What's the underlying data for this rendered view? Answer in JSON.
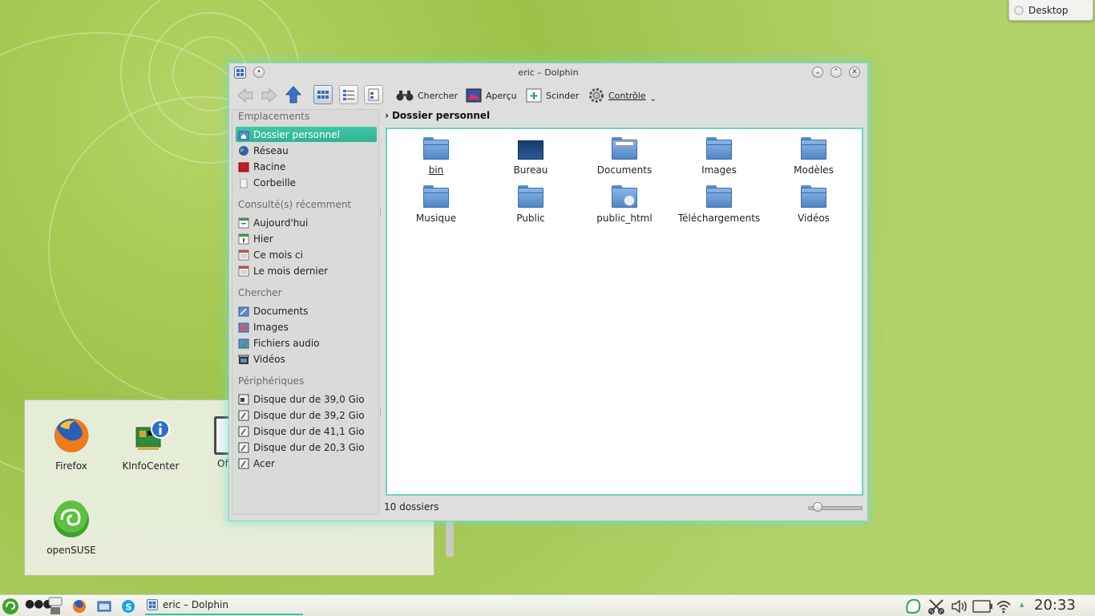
{
  "desktop_widget": {
    "label": "Desktop"
  },
  "folder_view": {
    "items": [
      {
        "label": "Firefox"
      },
      {
        "label": "KInfoCenter"
      },
      {
        "label": "Off"
      },
      {
        "label": "openSUSE"
      }
    ]
  },
  "window": {
    "title": "eric – Dolphin",
    "toolbar": {
      "search": "Chercher",
      "preview": "Aperçu",
      "split": "Scinder",
      "control": "Contrôle"
    },
    "places": {
      "groups": [
        {
          "label": "Emplacements",
          "items": [
            "Dossier personnel",
            "Réseau",
            "Racine",
            "Corbeille"
          ]
        },
        {
          "label": "Consulté(s) récemment",
          "items": [
            "Aujourd'hui",
            "Hier",
            "Ce mois ci",
            "Le mois dernier"
          ]
        },
        {
          "label": "Chercher",
          "items": [
            "Documents",
            "Images",
            "Fichiers audio",
            "Vidéos"
          ]
        },
        {
          "label": "Périphériques",
          "items": [
            "Disque dur de 39,0 Gio",
            "Disque dur de 39,2 Gio",
            "Disque dur de 41,1 Gio",
            "Disque dur de 20,3 Gio",
            "Acer"
          ]
        }
      ],
      "selected": "Dossier personnel"
    },
    "breadcrumb": "Dossier personnel",
    "files": [
      "bin",
      "Bureau",
      "Documents",
      "Images",
      "Modèles",
      "Musique",
      "Public",
      "public_html",
      "Téléchargements",
      "Vidéos"
    ],
    "status": "10 dossiers",
    "zoom_level": 0.1
  },
  "panel": {
    "task_label": "eric – Dolphin",
    "clock": "20:33"
  },
  "colors": {
    "accent": "#3fbf9f",
    "desktop": "#a8cb55",
    "folder": "#5b8dc9"
  }
}
